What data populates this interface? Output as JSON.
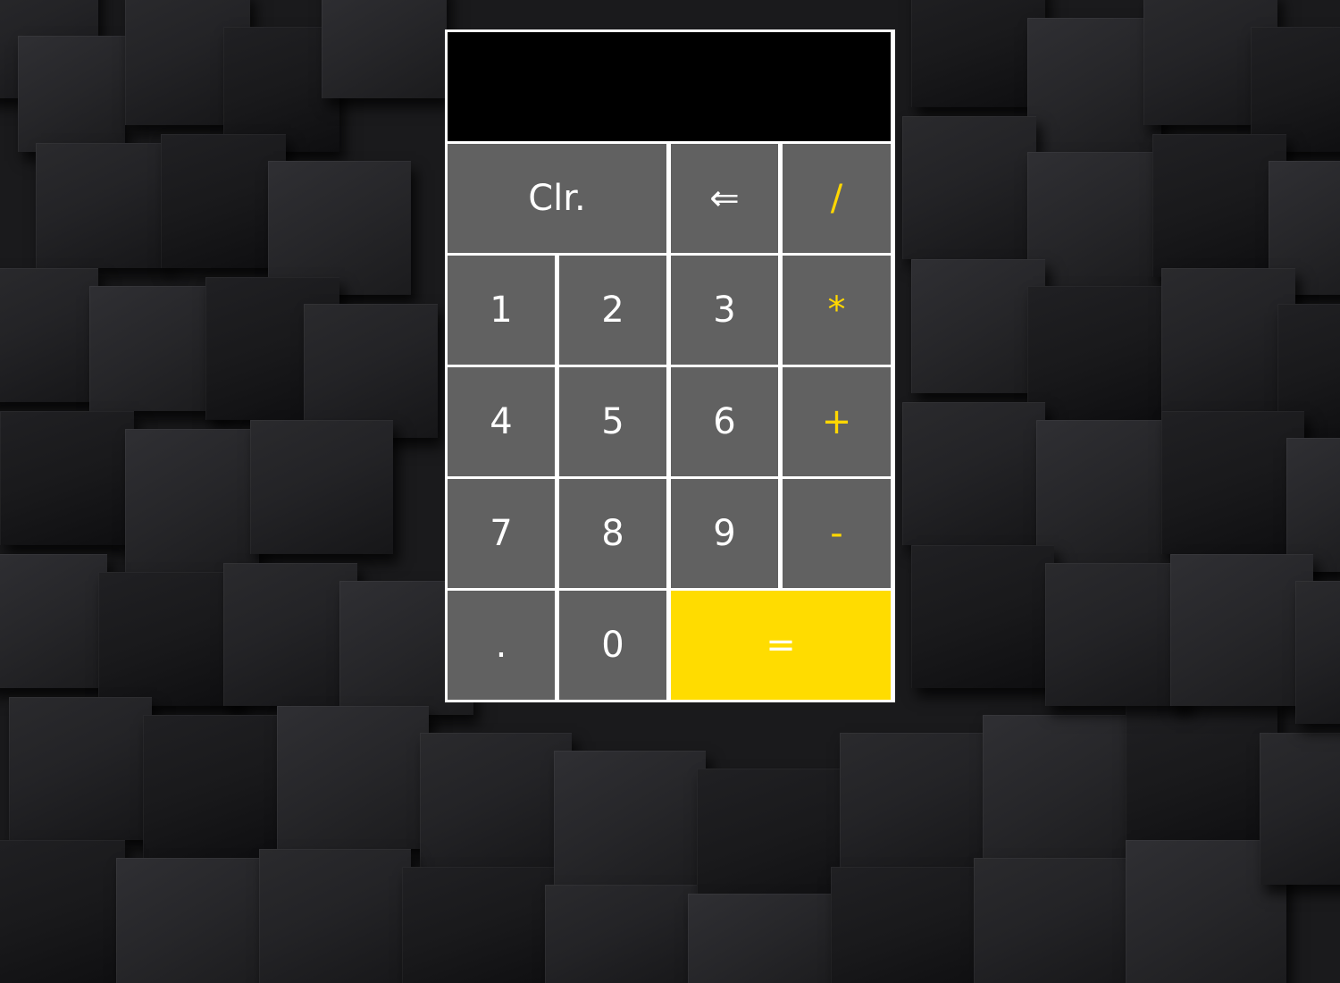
{
  "display": {
    "value": ""
  },
  "keys": {
    "clear": "Clr.",
    "backspace": "⇐",
    "divide": "/",
    "one": "1",
    "two": "2",
    "three": "3",
    "multiply": "*",
    "four": "4",
    "five": "5",
    "six": "6",
    "add": "+",
    "seven": "7",
    "eight": "8",
    "nine": "9",
    "subtract": "-",
    "decimal": ".",
    "zero": "0",
    "equals": "="
  },
  "colors": {
    "key_background": "#616161",
    "operator_text": "#ffd700",
    "equals_background": "#ffdc00",
    "display_background": "#000000",
    "border": "#ffffff"
  }
}
